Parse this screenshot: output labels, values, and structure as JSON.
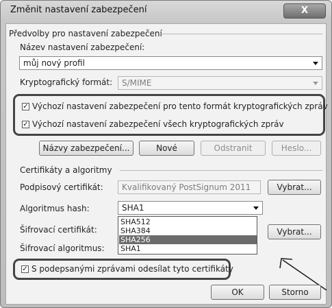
{
  "window": {
    "title": "Změnit nastavení zabezpečení",
    "close_label": "X"
  },
  "prefs": {
    "group_label": "Předvolby pro nastavení zabezpečení",
    "name_label": "Název nastavení zabezpečení:",
    "name_value": "můj nový profil",
    "crypto_format_label": "Kryptografický formát:",
    "crypto_format_value": "S/MIME",
    "default_format_checkbox": "Výchozí nastavení zabezpečení pro tento formát kryptografických zpráv",
    "default_all_checkbox": "Výchozí nastavení zabezpečení všech kryptografických zpráv",
    "buttons": {
      "names": "Názvy zabezpečení...",
      "new": "Nové",
      "delete": "Odstranit",
      "password": "Heslo..."
    }
  },
  "certs": {
    "group_label": "Certifikáty a algoritmy",
    "signing_label": "Podpisový certifikát:",
    "signing_value": "Kvalifikovaný PostSignum 2011",
    "choose1": "Vybrat...",
    "hash_label": "Algoritmus hash:",
    "hash_value": "SHA1",
    "hash_options": [
      "SHA512",
      "SHA384",
      "SHA256",
      "SHA1"
    ],
    "hash_selected_index": 2,
    "enc_label": "Šifrovací certifikát:",
    "choose2": "Vybrat...",
    "enc_alg_label": "Šifrovací algoritmus:",
    "send_certs_checkbox": "S podepsanými zprávami odesílat tyto certifikáty"
  },
  "footer": {
    "ok": "OK",
    "cancel": "Storno"
  }
}
